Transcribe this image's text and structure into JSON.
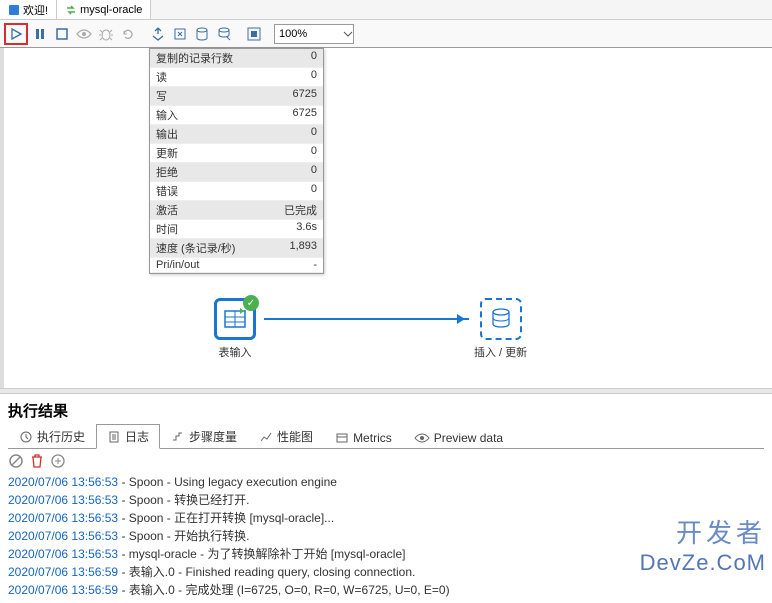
{
  "tabs": [
    {
      "label": "欢迎!",
      "icon": "welcome"
    },
    {
      "label": "mysql-oracle",
      "icon": "transform",
      "active": true
    }
  ],
  "toolbar": {
    "zoom": "100%"
  },
  "stats": [
    {
      "label": "复制的记录行数",
      "value": "0"
    },
    {
      "label": "读",
      "value": "0"
    },
    {
      "label": "写",
      "value": "6725"
    },
    {
      "label": "输入",
      "value": "6725"
    },
    {
      "label": "输出",
      "value": "0"
    },
    {
      "label": "更新",
      "value": "0"
    },
    {
      "label": "拒绝",
      "value": "0"
    },
    {
      "label": "错误",
      "value": "0"
    },
    {
      "label": "激活",
      "value": "已完成"
    },
    {
      "label": "时间",
      "value": "3.6s"
    },
    {
      "label": "速度 (条记录/秒)",
      "value": "1,893"
    },
    {
      "label": "Pri/in/out",
      "value": "-"
    }
  ],
  "nodes": {
    "input": {
      "label": "表输入"
    },
    "output": {
      "label": "插入 / 更新"
    }
  },
  "results": {
    "title": "执行结果",
    "tabs": [
      {
        "label": "执行历史",
        "icon": "history"
      },
      {
        "label": "日志",
        "icon": "log",
        "active": true
      },
      {
        "label": "步骤度量",
        "icon": "metrics"
      },
      {
        "label": "性能图",
        "icon": "chart"
      },
      {
        "label": "Metrics",
        "icon": "metrics2"
      },
      {
        "label": "Preview data",
        "icon": "preview"
      }
    ]
  },
  "log": [
    {
      "ts": "2020/07/06 13:56:53",
      "msg": " - Spoon - Using legacy execution engine"
    },
    {
      "ts": "2020/07/06 13:56:53",
      "msg": " - Spoon - 转换已经打开."
    },
    {
      "ts": "2020/07/06 13:56:53",
      "msg": " - Spoon - 正在打开转换 [mysql-oracle]..."
    },
    {
      "ts": "2020/07/06 13:56:53",
      "msg": " - Spoon - 开始执行转换."
    },
    {
      "ts": "2020/07/06 13:56:53",
      "msg": " - mysql-oracle - 为了转换解除补丁开始  [mysql-oracle]"
    },
    {
      "ts": "2020/07/06 13:56:59",
      "msg": " - 表输入.0 - Finished reading query, closing connection."
    },
    {
      "ts": "2020/07/06 13:56:59",
      "msg": " - 表输入.0 - 完成处理 (I=6725, O=0, R=0, W=6725, U=0, E=0)"
    }
  ],
  "watermark": {
    "cn": "开发者",
    "en": "DevZe.CoM"
  }
}
